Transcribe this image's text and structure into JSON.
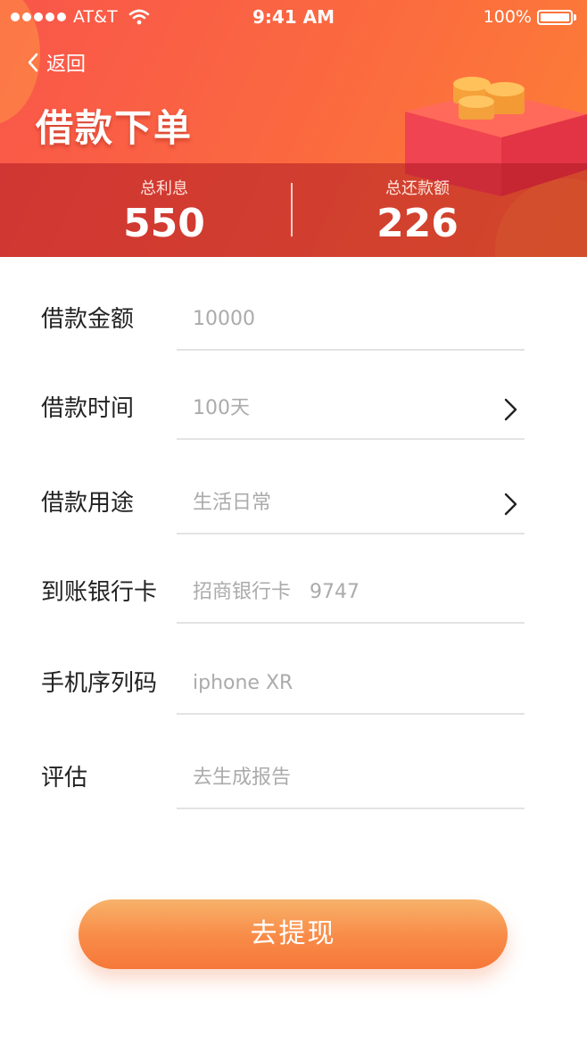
{
  "status_bar": {
    "carrier": "AT&T",
    "time": "9:41 AM",
    "battery": "100%"
  },
  "nav": {
    "back_label": "返回",
    "title": "借款下单"
  },
  "summary": {
    "interest_label": "总利息",
    "interest_value": "550",
    "repay_label": "总还款额",
    "repay_value": "226"
  },
  "form": {
    "rows": [
      {
        "label": "借款金额",
        "value": "10000"
      },
      {
        "label": "借款时间",
        "value": "100天"
      },
      {
        "label": "借款用途",
        "value": "生活日常"
      },
      {
        "label": "到账银行卡",
        "value": "招商银行卡   9747"
      },
      {
        "label": "手机序列码",
        "value": "iphone XR"
      },
      {
        "label": "评估",
        "value": "去生成报告"
      }
    ]
  },
  "submit_label": "去提现",
  "colors": {
    "header_start": "#f9564a",
    "header_end": "#fd7f36",
    "button_start": "#f7b26a",
    "button_end": "#f67839"
  }
}
